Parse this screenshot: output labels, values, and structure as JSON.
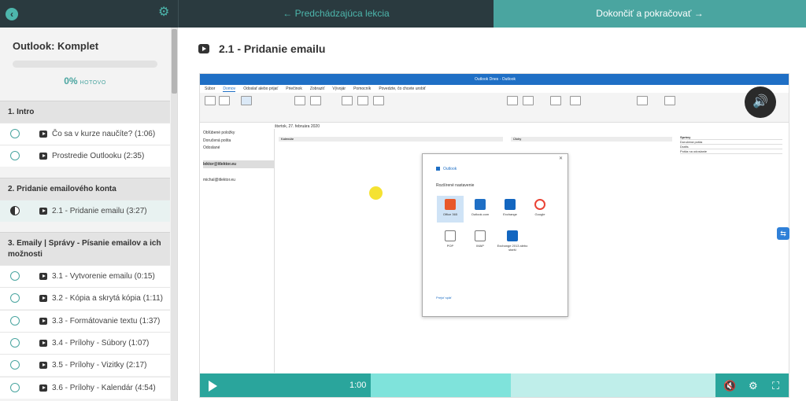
{
  "topbar": {
    "prev_label": "← Predchádzajúca lekcia",
    "next_label": "Dokončiť a pokračovať →"
  },
  "sidebar": {
    "course_title": "Outlook: Komplet",
    "progress_percent": 0,
    "progress_value": "0%",
    "progress_label": "HOTOVO",
    "sections": [
      {
        "title": "1. Intro",
        "lessons": [
          {
            "label": "Čo sa v kurze naučíte? (1:06)",
            "state": "empty"
          },
          {
            "label": "Prostredie Outlooku (2:35)",
            "state": "empty"
          }
        ]
      },
      {
        "title": "2. Pridanie emailového konta",
        "lessons": [
          {
            "label": "2.1 - Pridanie emailu (3:27)",
            "state": "in-progress"
          }
        ]
      },
      {
        "title": "3. Emaily | Správy - Písanie emailov a ich možnosti",
        "lessons": [
          {
            "label": "3.1 - Vytvorenie emailu (0:15)",
            "state": "empty"
          },
          {
            "label": "3.2 - Kópia a skrytá kópia (1:11)",
            "state": "empty"
          },
          {
            "label": "3.3 - Formátovanie textu (1:37)",
            "state": "empty"
          },
          {
            "label": "3.4 - Prílohy - Súbory (1:07)",
            "state": "empty"
          },
          {
            "label": "3.5 - Prílohy - Vizitky (2:17)",
            "state": "empty"
          },
          {
            "label": "3.6 - Prílohy - Kalendár (4:54)",
            "state": "empty"
          }
        ]
      }
    ]
  },
  "main": {
    "lesson_title": "2.1 - Pridanie emailu"
  },
  "video": {
    "outlook_title": "Outlook Dnes - Outlook",
    "tabs": [
      "Súbor",
      "Domov",
      "Odoslať alebo prijať",
      "Priečinok",
      "Zobraziť",
      "Vývojár",
      "Pomocník",
      "Povedzte, čo chcete urobiť"
    ],
    "date": "štvrtok, 27. februára 2020",
    "nav_items": [
      "Obľúbené položky",
      "Doručená pošta",
      "Odoslané",
      "lektor@itlektor.eu",
      "michal@itlektor.eu"
    ],
    "col_calendar": "Kalendár",
    "col_tasks": "Úlohy",
    "messages_header": "Správy",
    "messages": [
      "Doručená pošta",
      "Drafts",
      "Pošta na odoslanie"
    ],
    "dialog": {
      "app": "Outlook",
      "subtitle": "Rozšírené nastavenie",
      "options": [
        "Office 365",
        "Outlook.com",
        "Exchange",
        "Google",
        "POP",
        "IMAP",
        "Exchange 2013 alebo starší"
      ],
      "back_link": "Prejsť späť"
    },
    "time": "1:00",
    "progress": 0.53
  }
}
